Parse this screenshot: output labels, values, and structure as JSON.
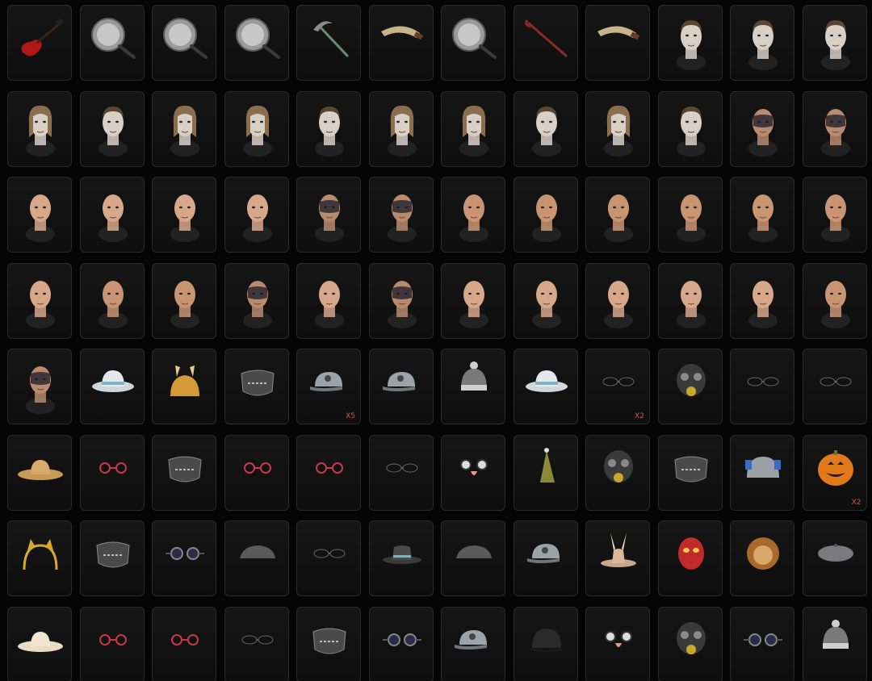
{
  "inventory": {
    "columns": 12,
    "colors": {
      "background": "#050505",
      "cell_border": "#2a2a2a",
      "count_text": "#d0543a"
    },
    "items": [
      {
        "icon": "electric-guitar-icon",
        "count": ""
      },
      {
        "icon": "frying-pan-icon",
        "count": ""
      },
      {
        "icon": "frying-pan-icon",
        "count": ""
      },
      {
        "icon": "frying-pan-icon",
        "count": ""
      },
      {
        "icon": "sickle-icon",
        "count": ""
      },
      {
        "icon": "machete-icon",
        "count": ""
      },
      {
        "icon": "frying-pan-icon",
        "count": ""
      },
      {
        "icon": "crowbar-icon",
        "count": ""
      },
      {
        "icon": "machete-icon",
        "count": ""
      },
      {
        "icon": "male-hairstyle-icon",
        "count": ""
      },
      {
        "icon": "male-hairstyle-icon",
        "count": ""
      },
      {
        "icon": "male-hairstyle-icon",
        "count": ""
      },
      {
        "icon": "female-hairstyle-icon",
        "count": ""
      },
      {
        "icon": "male-hairstyle-icon",
        "count": ""
      },
      {
        "icon": "female-hairstyle-icon",
        "count": ""
      },
      {
        "icon": "female-hairstyle-icon",
        "count": ""
      },
      {
        "icon": "male-hairstyle-icon",
        "count": ""
      },
      {
        "icon": "female-hairstyle-icon",
        "count": ""
      },
      {
        "icon": "female-hairstyle-icon",
        "count": ""
      },
      {
        "icon": "male-hairstyle-icon",
        "count": ""
      },
      {
        "icon": "female-hairstyle-icon",
        "count": ""
      },
      {
        "icon": "male-hairstyle-icon",
        "count": ""
      },
      {
        "icon": "face-paint-icon",
        "count": ""
      },
      {
        "icon": "face-paint-icon",
        "count": ""
      },
      {
        "icon": "female-face-icon",
        "count": ""
      },
      {
        "icon": "female-face-icon",
        "count": ""
      },
      {
        "icon": "female-face-icon",
        "count": ""
      },
      {
        "icon": "female-face-icon",
        "count": ""
      },
      {
        "icon": "face-paint-icon",
        "count": ""
      },
      {
        "icon": "face-paint-icon",
        "count": ""
      },
      {
        "icon": "male-face-icon",
        "count": ""
      },
      {
        "icon": "male-face-icon",
        "count": ""
      },
      {
        "icon": "male-face-icon",
        "count": ""
      },
      {
        "icon": "male-face-icon",
        "count": ""
      },
      {
        "icon": "male-face-icon",
        "count": ""
      },
      {
        "icon": "male-face-icon",
        "count": ""
      },
      {
        "icon": "female-face-icon",
        "count": ""
      },
      {
        "icon": "male-face-icon",
        "count": ""
      },
      {
        "icon": "male-face-icon",
        "count": ""
      },
      {
        "icon": "face-paint-icon",
        "count": ""
      },
      {
        "icon": "female-face-icon",
        "count": ""
      },
      {
        "icon": "face-paint-icon",
        "count": ""
      },
      {
        "icon": "female-face-icon",
        "count": ""
      },
      {
        "icon": "female-face-icon",
        "count": ""
      },
      {
        "icon": "female-face-icon",
        "count": ""
      },
      {
        "icon": "female-face-icon",
        "count": ""
      },
      {
        "icon": "female-face-icon",
        "count": ""
      },
      {
        "icon": "male-face-icon",
        "count": ""
      },
      {
        "icon": "face-paint-icon",
        "count": ""
      },
      {
        "icon": "bucket-hat-icon",
        "count": ""
      },
      {
        "icon": "chicken-hat-icon",
        "count": ""
      },
      {
        "icon": "mask-icon",
        "count": ""
      },
      {
        "icon": "baseball-cap-icon",
        "count": "X5"
      },
      {
        "icon": "baseball-cap-icon",
        "count": ""
      },
      {
        "icon": "beanie-icon",
        "count": ""
      },
      {
        "icon": "bucket-hat-icon",
        "count": ""
      },
      {
        "icon": "sunglasses-icon",
        "count": "X2"
      },
      {
        "icon": "gas-mask-icon",
        "count": ""
      },
      {
        "icon": "sunglasses-icon",
        "count": ""
      },
      {
        "icon": "sunglasses-icon",
        "count": ""
      },
      {
        "icon": "straw-hat-icon",
        "count": ""
      },
      {
        "icon": "glasses-icon",
        "count": ""
      },
      {
        "icon": "mask-icon",
        "count": ""
      },
      {
        "icon": "glasses-icon",
        "count": ""
      },
      {
        "icon": "glasses-icon",
        "count": ""
      },
      {
        "icon": "sunglasses-icon",
        "count": ""
      },
      {
        "icon": "novelty-glasses-icon",
        "count": ""
      },
      {
        "icon": "party-hat-icon",
        "count": ""
      },
      {
        "icon": "gas-mask-icon",
        "count": ""
      },
      {
        "icon": "mask-icon",
        "count": ""
      },
      {
        "icon": "helmet-icon",
        "count": ""
      },
      {
        "icon": "pumpkin-head-icon",
        "count": "X2"
      },
      {
        "icon": "cat-ears-headband-icon",
        "count": ""
      },
      {
        "icon": "mask-icon",
        "count": ""
      },
      {
        "icon": "goggles-icon",
        "count": ""
      },
      {
        "icon": "flat-cap-icon",
        "count": ""
      },
      {
        "icon": "sunglasses-icon",
        "count": ""
      },
      {
        "icon": "fedora-icon",
        "count": ""
      },
      {
        "icon": "flat-cap-icon",
        "count": ""
      },
      {
        "icon": "baseball-cap-icon",
        "count": ""
      },
      {
        "icon": "bunny-ears-hat-icon",
        "count": ""
      },
      {
        "icon": "luchador-mask-icon",
        "count": ""
      },
      {
        "icon": "lion-mask-icon",
        "count": ""
      },
      {
        "icon": "beret-icon",
        "count": ""
      },
      {
        "icon": "sun-hat-icon",
        "count": ""
      },
      {
        "icon": "glasses-icon",
        "count": ""
      },
      {
        "icon": "glasses-icon",
        "count": ""
      },
      {
        "icon": "sunglasses-icon",
        "count": ""
      },
      {
        "icon": "mask-icon",
        "count": ""
      },
      {
        "icon": "goggles-icon",
        "count": ""
      },
      {
        "icon": "baseball-cap-icon",
        "count": ""
      },
      {
        "icon": "riding-helmet-icon",
        "count": ""
      },
      {
        "icon": "novelty-glasses-icon",
        "count": ""
      },
      {
        "icon": "gas-mask-icon",
        "count": ""
      },
      {
        "icon": "goggles-icon",
        "count": ""
      },
      {
        "icon": "beanie-icon",
        "count": ""
      }
    ]
  }
}
